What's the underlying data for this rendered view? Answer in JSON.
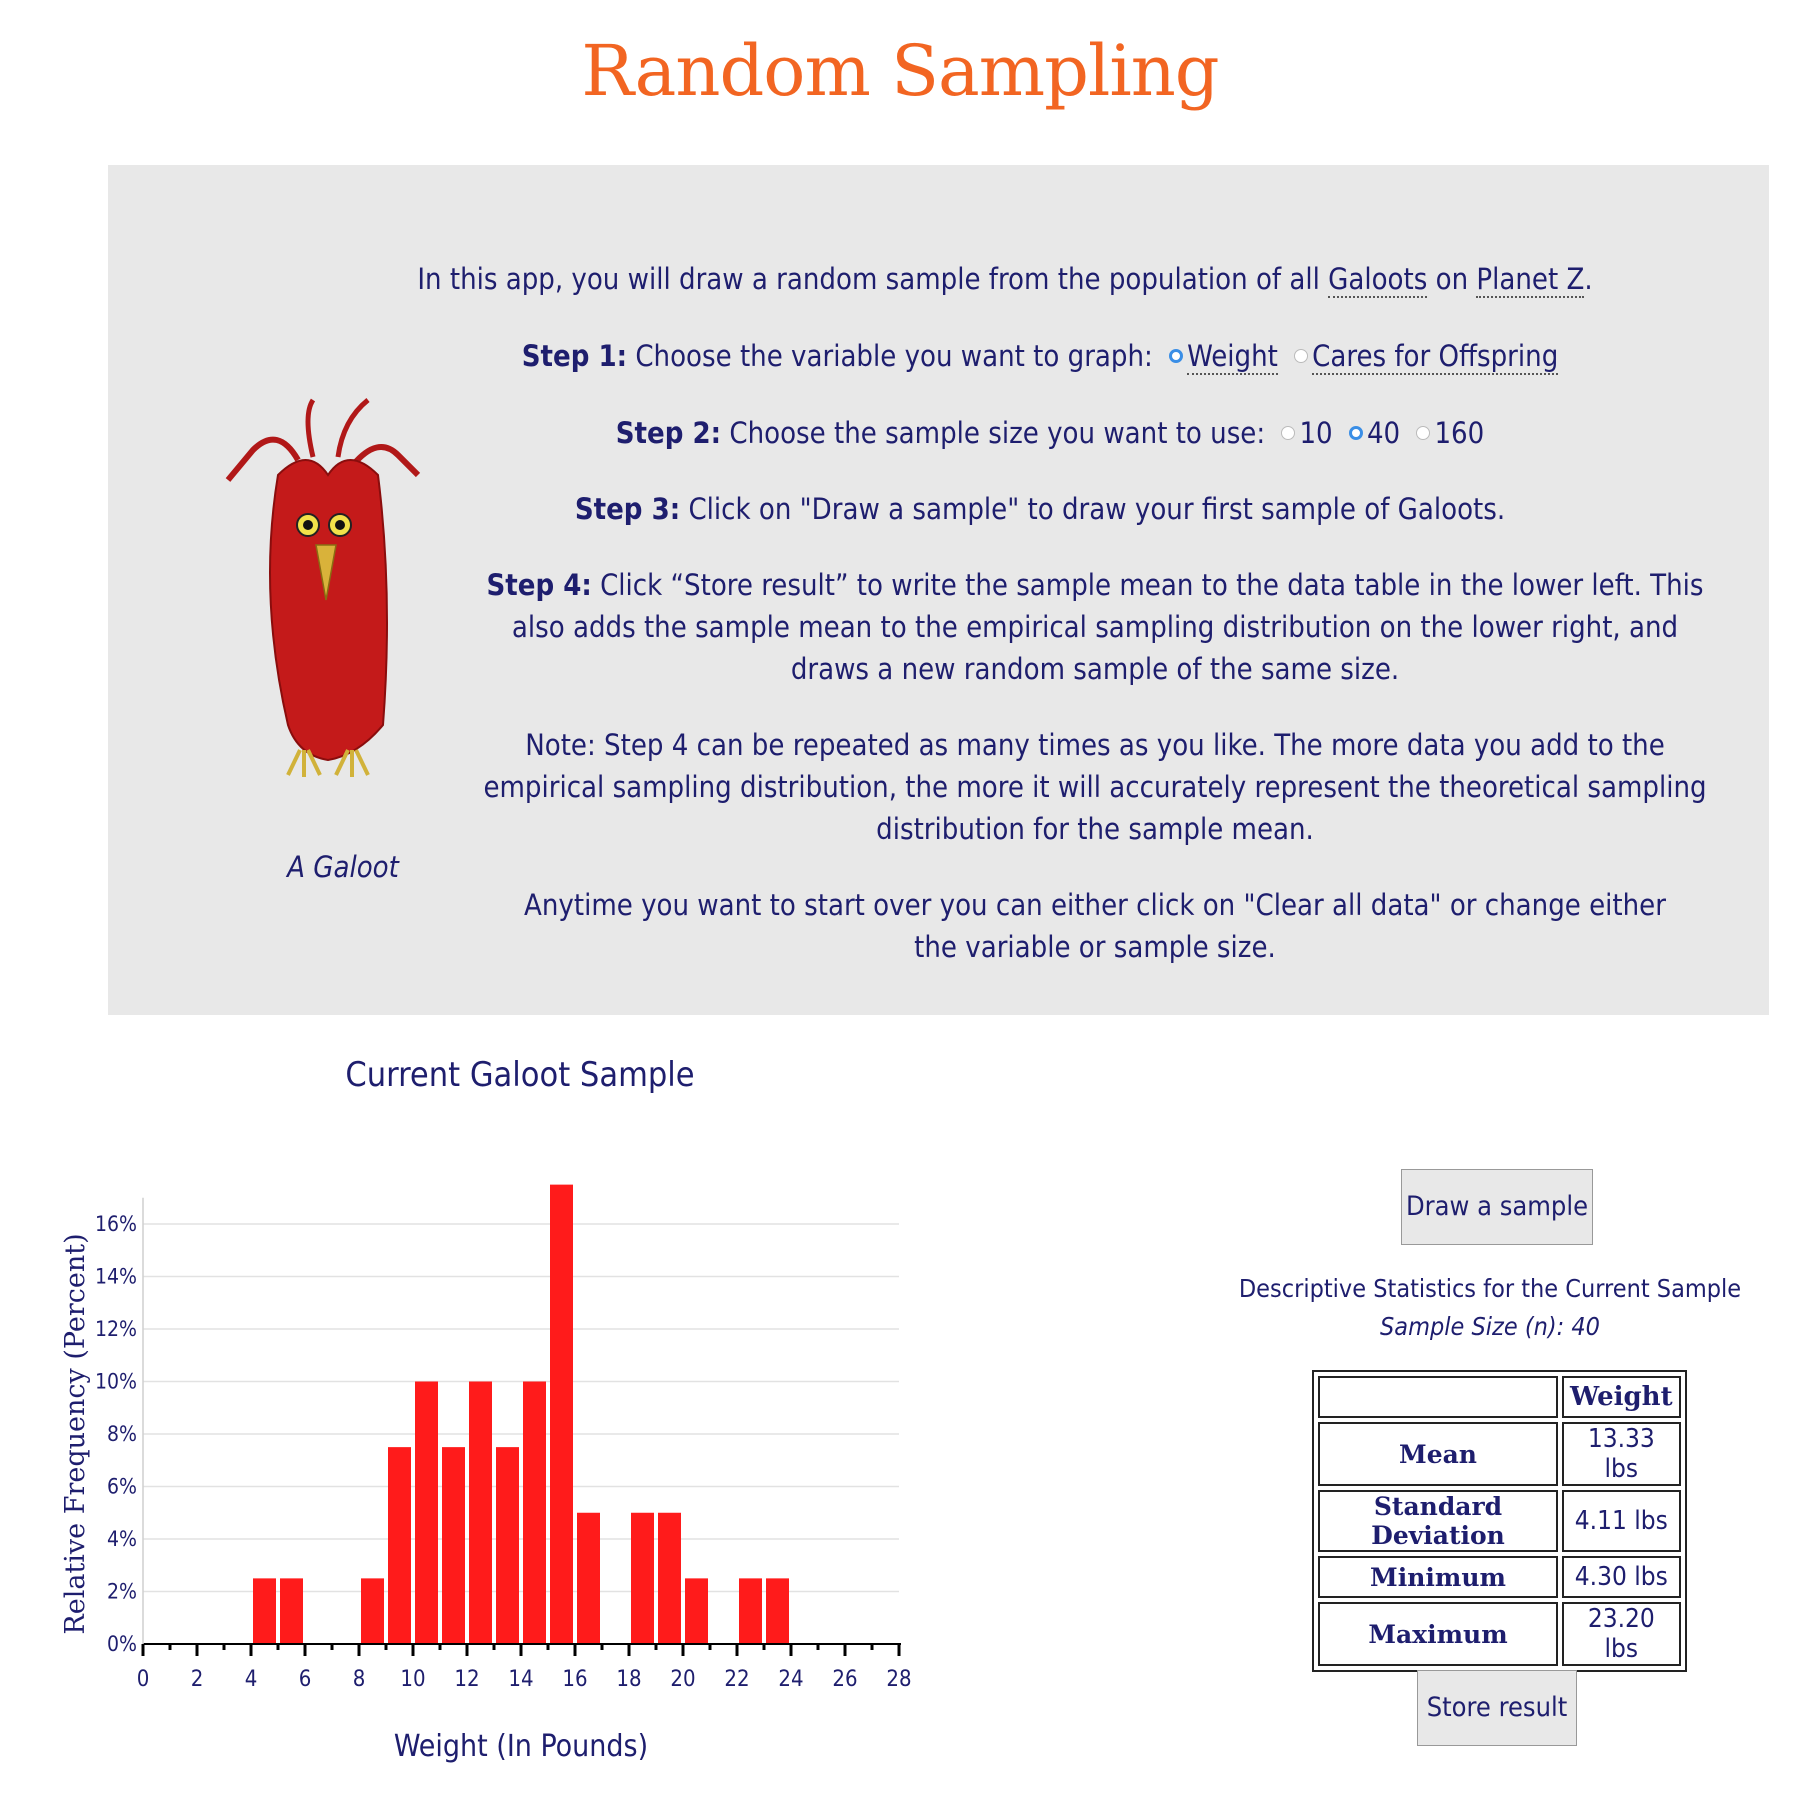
{
  "page": {
    "title": "Random Sampling"
  },
  "intro": {
    "galoot_caption": "A Galoot",
    "line1_pre": "In this app, you will draw a random sample from the population of all ",
    "line1_link1": "Galoots",
    "line1_mid": " on ",
    "line1_link2": "Planet Z",
    "line1_post": ".",
    "step1_label": "Step 1:",
    "step1_text": " Choose the variable you want to graph: ",
    "step1_options": [
      "Weight",
      "Cares for Offspring"
    ],
    "step1_selected": "Weight",
    "step2_label": "Step 2:",
    "step2_text": " Choose the sample size you want to use: ",
    "step2_options": [
      "10",
      "40",
      "160"
    ],
    "step2_selected": "40",
    "step3_label": "Step 3:",
    "step3_text": " Click on \"Draw a sample\" to draw your first sample of Galoots.",
    "step4_label": "Step 4:",
    "step4_text": " Click “Store result” to write the sample mean to the data table in the lower left. This also adds the sample mean to the empirical sampling distribution on the lower right, and draws a new random sample of the same size.",
    "note": "Note: Step 4 can be repeated as many times as you like. The more data you add to the empirical sampling distribution, the more it will accurately represent the theoretical sampling distribution for the sample mean.",
    "anytime": "Anytime you want to start over you can either click on \"Clear all data\" or change either the variable or sample size."
  },
  "chart_data": {
    "type": "bar",
    "title": "Current Galoot Sample",
    "xlabel": "Weight (In Pounds)",
    "ylabel": "Relative Frequency (Percent)",
    "x_ticks": [
      0,
      2,
      4,
      6,
      8,
      10,
      12,
      14,
      16,
      18,
      20,
      22,
      24,
      26,
      28
    ],
    "y_ticks": [
      "0%",
      "2%",
      "4%",
      "6%",
      "8%",
      "10%",
      "12%",
      "14%",
      "16%"
    ],
    "xlim": [
      0,
      28
    ],
    "ylim": [
      0,
      16
    ],
    "grid": true,
    "bins": [
      {
        "x0": 4,
        "value": 2.5
      },
      {
        "x0": 5,
        "value": 2.5
      },
      {
        "x0": 8,
        "value": 2.5
      },
      {
        "x0": 9,
        "value": 7.5
      },
      {
        "x0": 10,
        "value": 10
      },
      {
        "x0": 11,
        "value": 7.5
      },
      {
        "x0": 12,
        "value": 10
      },
      {
        "x0": 13,
        "value": 7.5
      },
      {
        "x0": 14,
        "value": 10
      },
      {
        "x0": 15,
        "value": 17.5
      },
      {
        "x0": 16,
        "value": 5
      },
      {
        "x0": 18,
        "value": 5
      },
      {
        "x0": 19,
        "value": 5
      },
      {
        "x0": 20,
        "value": 2.5
      },
      {
        "x0": 22,
        "value": 2.5
      },
      {
        "x0": 23,
        "value": 2.5
      }
    ],
    "bar_color": "#ff1b1b"
  },
  "controls": {
    "draw_sample": "Draw a sample",
    "store_result": "Store result"
  },
  "stats": {
    "heading": "Descriptive Statistics for the Current Sample",
    "sample_size": "Sample Size (n): 40",
    "column": "Weight",
    "rows": [
      {
        "label": "Mean",
        "value": "13.33 lbs"
      },
      {
        "label": "Standard Deviation",
        "value": "4.11 lbs"
      },
      {
        "label": "Minimum",
        "value": "4.30 lbs"
      },
      {
        "label": "Maximum",
        "value": "23.20 lbs"
      }
    ]
  }
}
